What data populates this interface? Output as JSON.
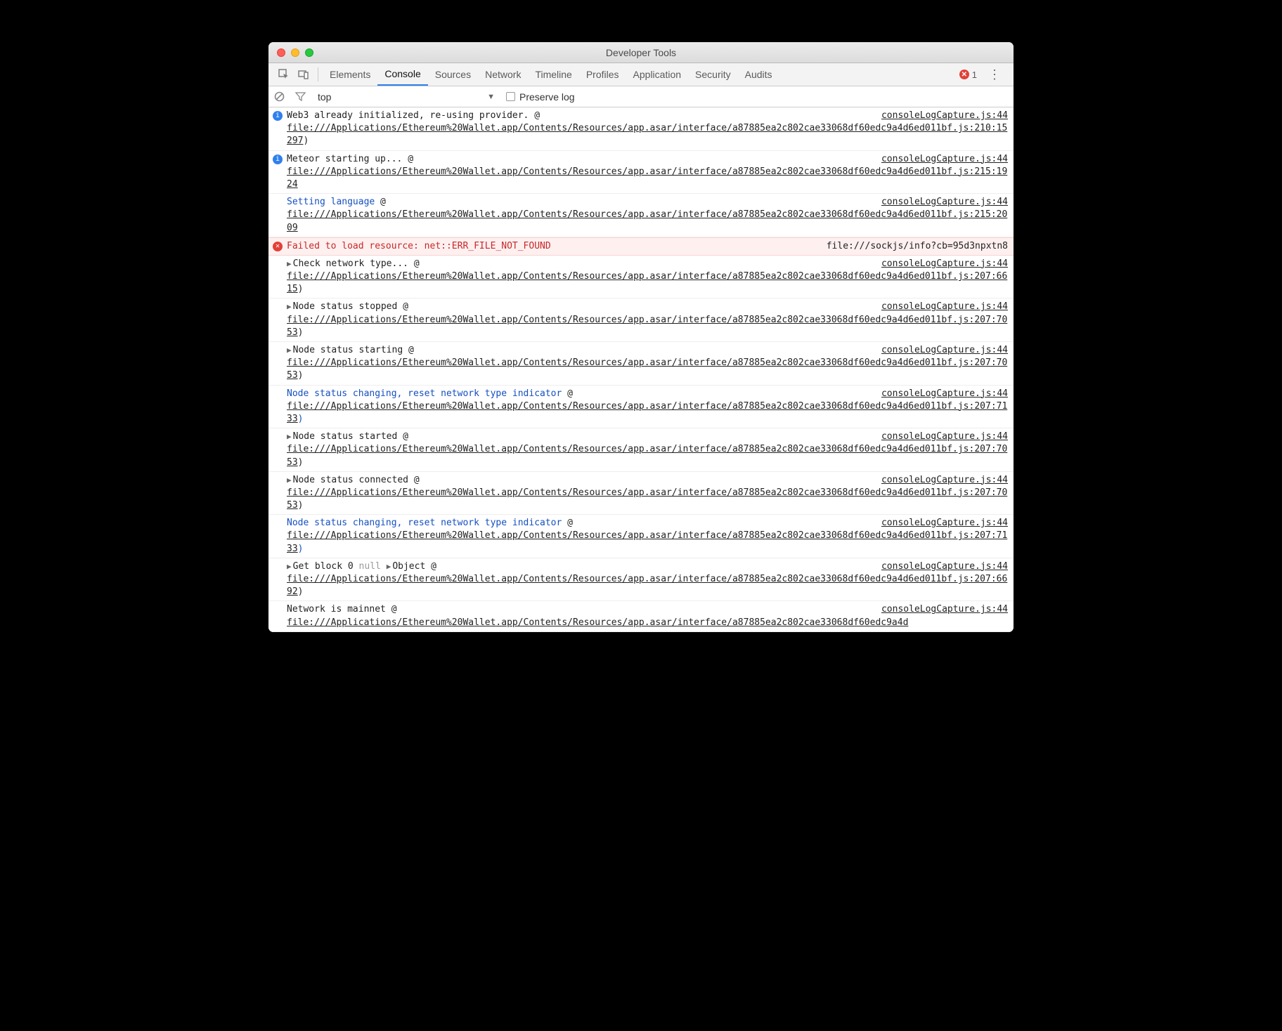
{
  "window": {
    "title": "Developer Tools"
  },
  "tabs": {
    "items": [
      "Elements",
      "Console",
      "Sources",
      "Network",
      "Timeline",
      "Profiles",
      "Application",
      "Security",
      "Audits"
    ],
    "active": "Console",
    "error_count": "1"
  },
  "toolbar": {
    "context": "top",
    "preserve_log": "Preserve log"
  },
  "default_source": "consoleLogCapture.js:44",
  "file_prefix": "file:///Applications/Ethereum%20Wallet.app/Contents/Resources/app.asar/interface/a87885ea2c802cae33068df60edc9a4d6ed011bf.js:",
  "rows": [
    {
      "type": "info",
      "msg": "Web3 already initialized, re-using provider.",
      "at": "@",
      "loc": "210:15297",
      "trail": ")"
    },
    {
      "type": "info",
      "msg": "Meteor starting up...",
      "at": "@",
      "loc": "215:1924",
      "trail": ""
    },
    {
      "type": "plain",
      "blue": true,
      "msg": "Setting language",
      "at": "@",
      "loc": "215:2009",
      "trail": ""
    },
    {
      "type": "error",
      "msg": "Failed to load resource: net::ERR_FILE_NOT_FOUND",
      "err_url": "file:///sockjs/info?cb=95d3npxtn8"
    },
    {
      "type": "expand",
      "msg": "Check network type...",
      "at": "@",
      "loc": "207:6615",
      "trail": ")"
    },
    {
      "type": "expand",
      "msg": "Node status stopped",
      "at": "@",
      "loc": "207:7053",
      "trail": ")"
    },
    {
      "type": "expand",
      "msg": "Node status starting",
      "at": "@",
      "loc": "207:7053",
      "trail": ")"
    },
    {
      "type": "plain",
      "blue": true,
      "msg": "Node status changing, reset network type indicator",
      "at": "@",
      "loc": "207:7133",
      "trail": ")",
      "trail_blue": true
    },
    {
      "type": "expand",
      "msg": "Node status started",
      "at": "@",
      "loc": "207:7053",
      "trail": ")"
    },
    {
      "type": "expand",
      "msg": "Node status connected",
      "at": "@",
      "loc": "207:7053",
      "trail": ")"
    },
    {
      "type": "plain",
      "blue": true,
      "msg": "Node status changing, reset network type indicator",
      "at": "@",
      "loc": "207:7133",
      "trail": ")",
      "trail_blue": true
    },
    {
      "type": "object",
      "pre": "Get block 0 ",
      "grey": "null",
      "obj": "Object",
      "at": "@",
      "loc": "207:6692",
      "trail": ")"
    },
    {
      "type": "plain",
      "msg": "Network is mainnet",
      "at": "@",
      "loc": "",
      "trail": "",
      "partial": true
    }
  ]
}
